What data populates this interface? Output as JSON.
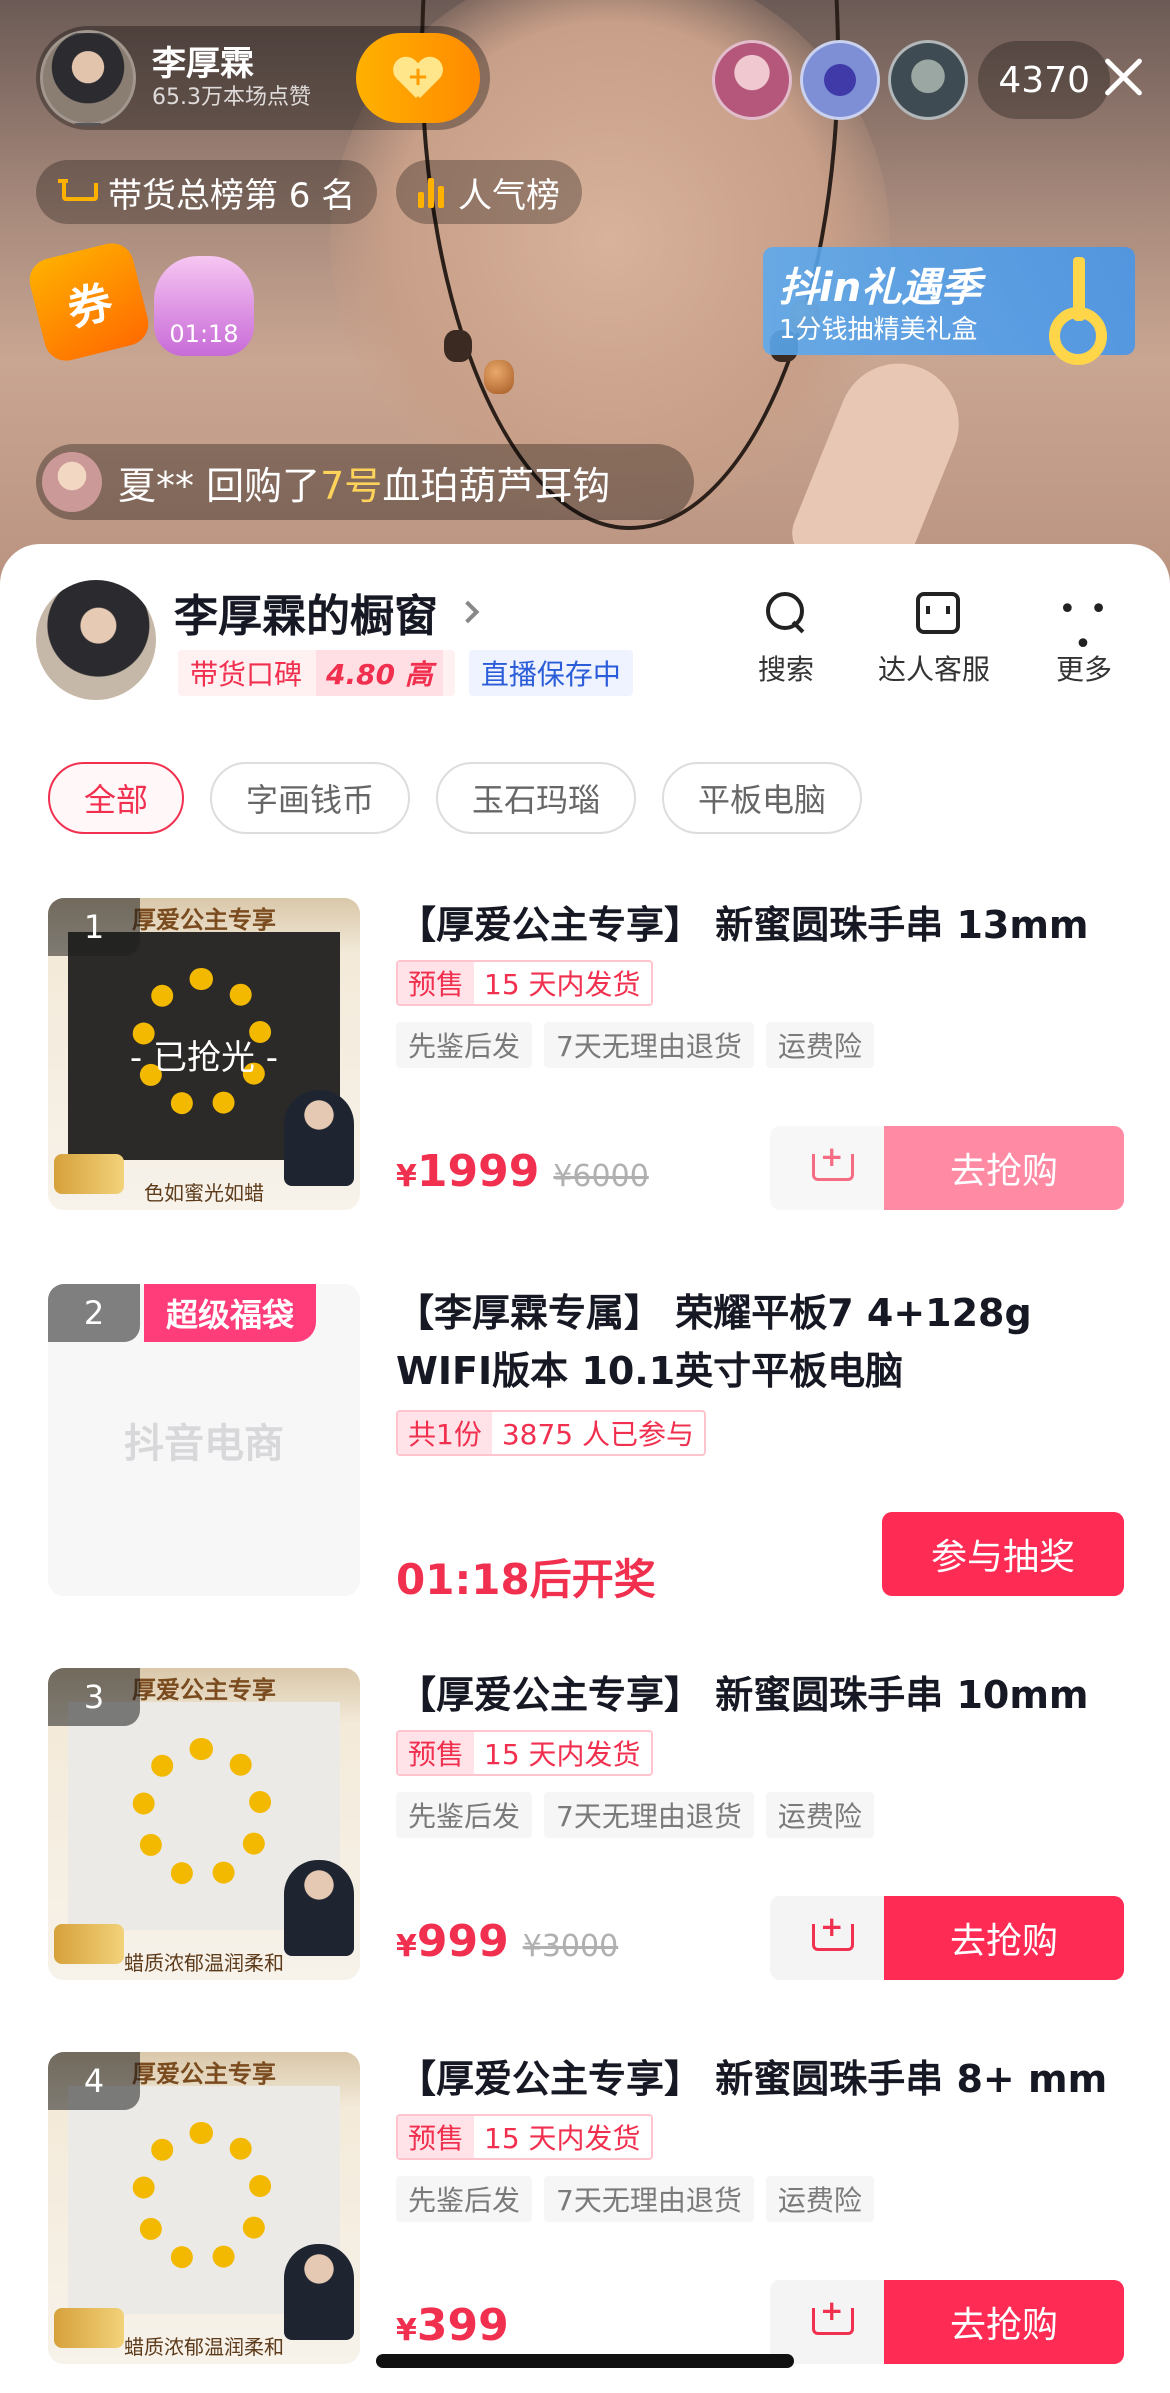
{
  "live": {
    "anchor_name": "李厚霖",
    "likes": "65.3万本场点赞",
    "follow_label": "+",
    "viewer_count": "4370",
    "rank_label": "带货总榜第 6 名",
    "popularity_label": "人气榜",
    "coupon_label": "券",
    "bag_timer": "01:18",
    "promo_title": "抖in礼遇季",
    "promo_sub": "1分钱抽精美礼盒",
    "buyer_name": "夏**",
    "buyer_action": "回购了",
    "buyer_item_no": "7号",
    "buyer_item": "血珀葫芦耳钩"
  },
  "shop": {
    "title": "李厚霖的橱窗",
    "reputation_label": "带货口碑",
    "reputation_score": "4.80 高",
    "status": "直播保存中",
    "tools": [
      {
        "label": "搜索"
      },
      {
        "label": "达人客服"
      },
      {
        "label": "更多"
      }
    ]
  },
  "categories": [
    {
      "label": "全部",
      "active": true
    },
    {
      "label": "字画钱币",
      "active": false
    },
    {
      "label": "玉石玛瑙",
      "active": false
    },
    {
      "label": "平板电脑",
      "active": false
    }
  ],
  "items": [
    {
      "index": "1",
      "title": "【厚爱公主专享】 新蜜圆珠手串 13mm",
      "badge_a": "预售",
      "badge_b": "15 天内发货",
      "services": [
        "先鉴后发",
        "7天无理由退货",
        "运费险"
      ],
      "currency": "¥",
      "price": "1999",
      "orig_price": "¥6000",
      "buy_label": "去抢购",
      "sold_out": "- 已抢光 -",
      "thumb_header": "厚爱公主专享",
      "thumb_footer": "色如蜜光如蜡"
    },
    {
      "index": "2",
      "badge": "超级福袋",
      "title": "【李厚霖专属】 荣耀平板7 4+128g WIFI版本 10.1英寸平板电脑",
      "lot_a": "共1份",
      "lot_b": "3875 人已参与",
      "countdown": "01:18后开奖",
      "action": "参与抽奖",
      "placeholder": "抖音电商"
    },
    {
      "index": "3",
      "title": "【厚爱公主专享】 新蜜圆珠手串 10mm",
      "badge_a": "预售",
      "badge_b": "15 天内发货",
      "services": [
        "先鉴后发",
        "7天无理由退货",
        "运费险"
      ],
      "currency": "¥",
      "price": "999",
      "orig_price": "¥3000",
      "buy_label": "去抢购",
      "thumb_header": "厚爱公主专享",
      "thumb_footer": "蜡质浓郁温润柔和"
    },
    {
      "index": "4",
      "title": "【厚爱公主专享】 新蜜圆珠手串 8+ mm",
      "badge_a": "预售",
      "badge_b": "15 天内发货",
      "services": [
        "先鉴后发",
        "7天无理由退货",
        "运费险"
      ],
      "currency": "¥",
      "price": "399",
      "orig_price": "",
      "buy_label": "去抢购",
      "thumb_header": "厚爱公主专享",
      "thumb_footer": "蜡质浓郁温润柔和"
    }
  ],
  "colors": {
    "accent": "#fe2c55",
    "price": "#f1304f",
    "gold": "#ffb100"
  }
}
